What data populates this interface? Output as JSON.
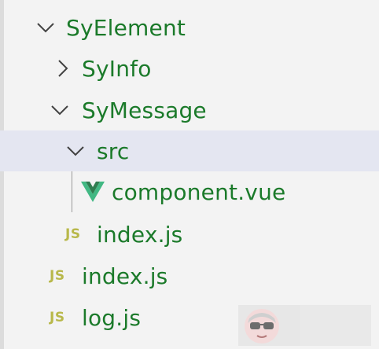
{
  "tree": {
    "items": [
      {
        "label": "SyElement",
        "kind": "folder",
        "state": "expanded",
        "depth": 0
      },
      {
        "label": "SyInfo",
        "kind": "folder",
        "state": "collapsed",
        "depth": 1
      },
      {
        "label": "SyMessage",
        "kind": "folder",
        "state": "expanded",
        "depth": 1
      },
      {
        "label": "src",
        "kind": "folder",
        "state": "expanded",
        "depth": 2,
        "selected": true
      },
      {
        "label": "component.vue",
        "kind": "file",
        "icon": "vue-icon",
        "depth": 3
      },
      {
        "label": "index.js",
        "kind": "file",
        "icon": "js-icon",
        "depth": 2
      },
      {
        "label": "index.js",
        "kind": "file",
        "icon": "js-icon",
        "depth": 1
      },
      {
        "label": "log.js",
        "kind": "file",
        "icon": "js-icon",
        "depth": 1
      }
    ]
  },
  "icons": {
    "js_text": "JS"
  },
  "colors": {
    "label": "#1b7a2a",
    "selected_row": "#e4e6f1",
    "background": "#f3f3f3",
    "js_icon": "#b8b84a",
    "vue_icon": "#41b883"
  }
}
